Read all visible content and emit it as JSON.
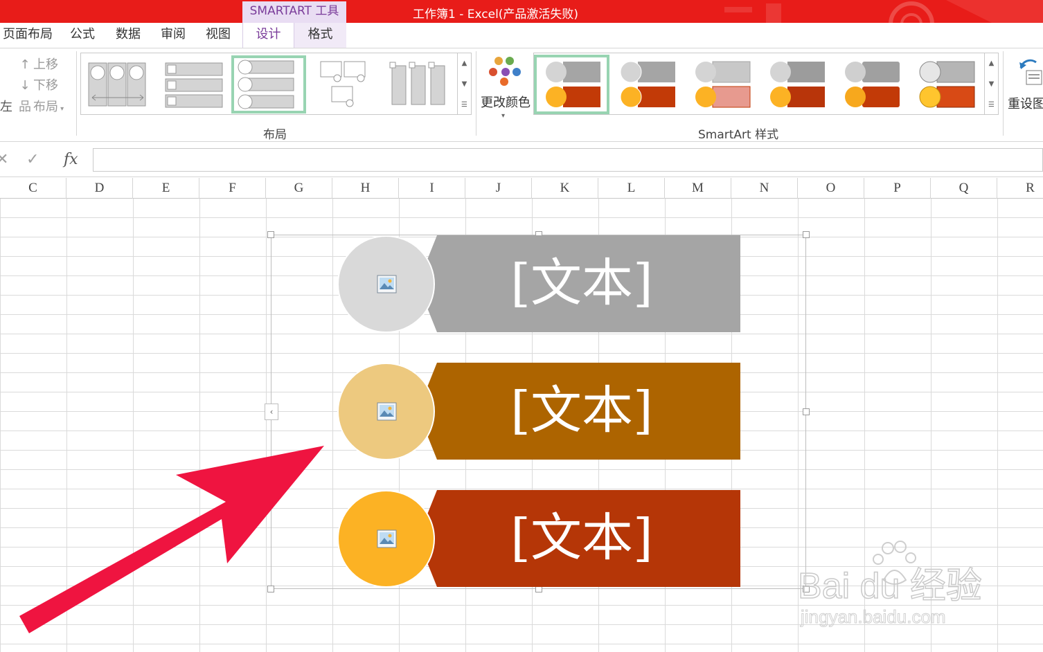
{
  "titlebar": {
    "context_tab_label": "SMARTART 工具",
    "window_title": "工作簿1 -  Excel(产品激活失败)"
  },
  "tabs": [
    {
      "label": "页面布局"
    },
    {
      "label": "公式"
    },
    {
      "label": "数据"
    },
    {
      "label": "审阅"
    },
    {
      "label": "视图"
    },
    {
      "label": "设计",
      "active": true
    },
    {
      "label": "格式"
    }
  ],
  "ribbon": {
    "create_group": {
      "move_up": "上移",
      "move_down": "下移",
      "left_label": "左",
      "layout_button": "布局"
    },
    "layouts_group_label": "布局",
    "change_colors": "更改颜色",
    "styles_group_label": "SmartArt 样式",
    "reset_graphic": "重设图"
  },
  "formula_bar": {
    "cancel_glyph": "✕",
    "enter_glyph": "✓",
    "fx_label": "fx",
    "value": ""
  },
  "columns": [
    "C",
    "D",
    "E",
    "F",
    "G",
    "H",
    "I",
    "J",
    "K",
    "L",
    "M",
    "N",
    "O",
    "P",
    "Q",
    "R"
  ],
  "smartart": {
    "items": [
      {
        "text": "[文本]",
        "bar_color": "#a5a5a5",
        "circle_color": "#d9d9d9"
      },
      {
        "text": "[文本]",
        "bar_color": "#ad6400",
        "circle_color": "#edc97f"
      },
      {
        "text": "[文本]",
        "bar_color": "#b53607",
        "circle_color": "#fcb224"
      }
    ]
  },
  "annotation": {
    "arrow_color": "#ef1440"
  },
  "watermark": {
    "brand": "Bai du 经验",
    "url": "jingyan.baidu.com"
  },
  "colors": {
    "titlebar": "#e81c19",
    "accent_purple": "#7a3c9a",
    "selected_green": "#98d4b2"
  }
}
